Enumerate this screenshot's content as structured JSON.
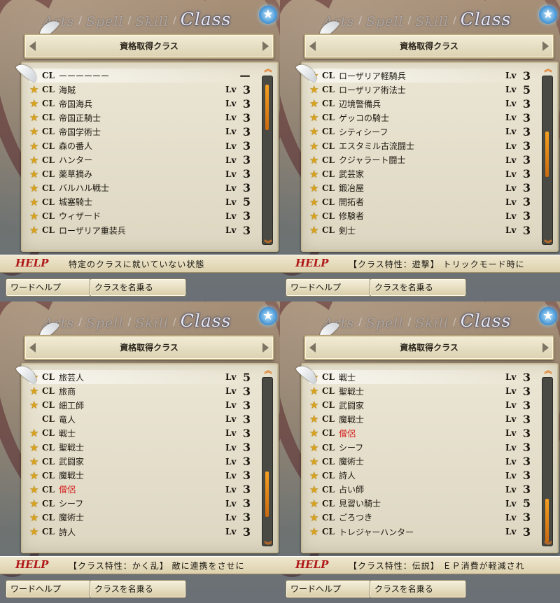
{
  "tabs": [
    {
      "label": "Arts",
      "active": false
    },
    {
      "label": "Spell",
      "active": false
    },
    {
      "label": "Skill",
      "active": false
    },
    {
      "label": "Class",
      "active": true
    }
  ],
  "tab_separator": "/",
  "star_badge": "★",
  "header_title": "資格取得クラス",
  "buttons": {
    "word_help": "ワードヘルプ",
    "class_name": "クラスを名乗る"
  },
  "help_label": "HELP",
  "cl_prefix": "CL",
  "lv_prefix": "Lv",
  "scroll_up": "︽",
  "scroll_down": "︾",
  "colors": {
    "star": "#d9a21e",
    "highlight_text": "#d41a1a",
    "help_label": "#b01818",
    "scroll_thumb": "#f5a020"
  },
  "panels": [
    {
      "help_text": "特定のクラスに就いていない状態",
      "scroll_thumb": {
        "start": 0.05,
        "end": 0.32
      },
      "feather_row": 0,
      "rows": [
        {
          "star": false,
          "name": "ーーーーーー",
          "lv": "",
          "value": "ー",
          "red": false,
          "highlight": true
        },
        {
          "star": true,
          "name": "海賊",
          "lv": "Lv",
          "value": "3",
          "red": false
        },
        {
          "star": true,
          "name": "帝国海兵",
          "lv": "Lv",
          "value": "3",
          "red": false
        },
        {
          "star": true,
          "name": "帝国正騎士",
          "lv": "Lv",
          "value": "3",
          "red": false
        },
        {
          "star": true,
          "name": "帝国学術士",
          "lv": "Lv",
          "value": "3",
          "red": false
        },
        {
          "star": true,
          "name": "森の番人",
          "lv": "Lv",
          "value": "3",
          "red": false
        },
        {
          "star": true,
          "name": "ハンター",
          "lv": "Lv",
          "value": "3",
          "red": false
        },
        {
          "star": true,
          "name": "薬草摘み",
          "lv": "Lv",
          "value": "3",
          "red": false
        },
        {
          "star": true,
          "name": "バルハル戦士",
          "lv": "Lv",
          "value": "3",
          "red": false
        },
        {
          "star": true,
          "name": "城塞騎士",
          "lv": "Lv",
          "value": "5",
          "red": false
        },
        {
          "star": true,
          "name": "ウィザード",
          "lv": "Lv",
          "value": "3",
          "red": false
        },
        {
          "star": true,
          "name": "ローザリア重装兵",
          "lv": "Lv",
          "value": "3",
          "red": false
        }
      ]
    },
    {
      "help_text": "【クラス特性：遊撃】 トリックモード時に",
      "scroll_thumb": {
        "start": 0.33,
        "end": 0.6
      },
      "feather_row": 0,
      "rows": [
        {
          "star": true,
          "name": "ローザリア軽騎兵",
          "lv": "Lv",
          "value": "3",
          "red": false,
          "highlight": true
        },
        {
          "star": true,
          "name": "ローザリア術法士",
          "lv": "Lv",
          "value": "5",
          "red": false
        },
        {
          "star": true,
          "name": "辺境警備兵",
          "lv": "Lv",
          "value": "3",
          "red": false
        },
        {
          "star": true,
          "name": "ゲッコの騎士",
          "lv": "Lv",
          "value": "3",
          "red": false
        },
        {
          "star": true,
          "name": "シティシーフ",
          "lv": "Lv",
          "value": "3",
          "red": false
        },
        {
          "star": true,
          "name": "エスタミル古流闘士",
          "lv": "Lv",
          "value": "3",
          "red": false
        },
        {
          "star": true,
          "name": "クジャラート闘士",
          "lv": "Lv",
          "value": "3",
          "red": false
        },
        {
          "star": true,
          "name": "武芸家",
          "lv": "Lv",
          "value": "3",
          "red": false
        },
        {
          "star": true,
          "name": "鍛冶屋",
          "lv": "Lv",
          "value": "3",
          "red": false
        },
        {
          "star": true,
          "name": "開拓者",
          "lv": "Lv",
          "value": "3",
          "red": false
        },
        {
          "star": true,
          "name": "修験者",
          "lv": "Lv",
          "value": "3",
          "red": false
        },
        {
          "star": true,
          "name": "剣士",
          "lv": "Lv",
          "value": "3",
          "red": false
        }
      ]
    },
    {
      "help_text": "【クラス特性：かく乱】 敵に連携をさせに",
      "scroll_thumb": {
        "start": 0.56,
        "end": 0.83
      },
      "feather_row": 0,
      "rows": [
        {
          "star": true,
          "name": "旅芸人",
          "lv": "Lv",
          "value": "5",
          "red": false,
          "highlight": true
        },
        {
          "star": true,
          "name": "旅商",
          "lv": "Lv",
          "value": "3",
          "red": false
        },
        {
          "star": true,
          "name": "細工師",
          "lv": "Lv",
          "value": "3",
          "red": false
        },
        {
          "star": false,
          "name": "竜人",
          "lv": "Lv",
          "value": "3",
          "red": false
        },
        {
          "star": true,
          "name": "戦士",
          "lv": "Lv",
          "value": "3",
          "red": false
        },
        {
          "star": true,
          "name": "聖戦士",
          "lv": "Lv",
          "value": "3",
          "red": false
        },
        {
          "star": true,
          "name": "武闘家",
          "lv": "Lv",
          "value": "3",
          "red": false
        },
        {
          "star": true,
          "name": "魔戦士",
          "lv": "Lv",
          "value": "3",
          "red": false
        },
        {
          "star": true,
          "name": "僧侶",
          "lv": "Lv",
          "value": "3",
          "red": true
        },
        {
          "star": true,
          "name": "シーフ",
          "lv": "Lv",
          "value": "3",
          "red": false
        },
        {
          "star": true,
          "name": "魔術士",
          "lv": "Lv",
          "value": "3",
          "red": false
        },
        {
          "star": true,
          "name": "詩人",
          "lv": "Lv",
          "value": "3",
          "red": false
        }
      ]
    },
    {
      "help_text": "【クラス特性：伝説】 ＥＰ消費が軽減され",
      "scroll_thumb": {
        "start": 0.72,
        "end": 0.98
      },
      "feather_row": 0,
      "rows": [
        {
          "star": true,
          "name": "戦士",
          "lv": "Lv",
          "value": "3",
          "red": false,
          "highlight": true
        },
        {
          "star": true,
          "name": "聖戦士",
          "lv": "Lv",
          "value": "3",
          "red": false
        },
        {
          "star": true,
          "name": "武闘家",
          "lv": "Lv",
          "value": "3",
          "red": false
        },
        {
          "star": true,
          "name": "魔戦士",
          "lv": "Lv",
          "value": "3",
          "red": false
        },
        {
          "star": true,
          "name": "僧侶",
          "lv": "Lv",
          "value": "3",
          "red": true
        },
        {
          "star": true,
          "name": "シーフ",
          "lv": "Lv",
          "value": "3",
          "red": false
        },
        {
          "star": true,
          "name": "魔術士",
          "lv": "Lv",
          "value": "3",
          "red": false
        },
        {
          "star": true,
          "name": "詩人",
          "lv": "Lv",
          "value": "3",
          "red": false
        },
        {
          "star": true,
          "name": "占い師",
          "lv": "Lv",
          "value": "3",
          "red": false
        },
        {
          "star": true,
          "name": "見習い騎士",
          "lv": "Lv",
          "value": "5",
          "red": false
        },
        {
          "star": true,
          "name": "ごろつき",
          "lv": "Lv",
          "value": "3",
          "red": false
        },
        {
          "star": true,
          "name": "トレジャーハンター",
          "lv": "Lv",
          "value": "3",
          "red": false
        }
      ]
    }
  ]
}
